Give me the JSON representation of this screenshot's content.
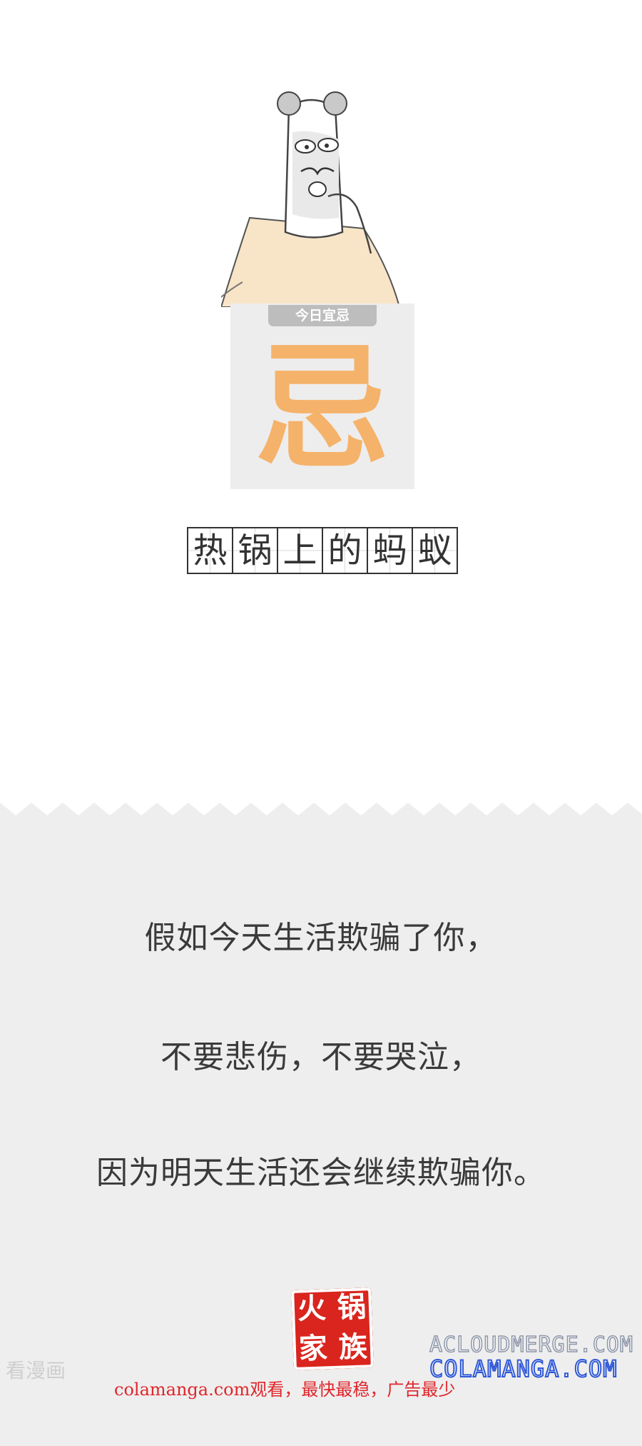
{
  "card": {
    "tag": "今日宜忌",
    "glyph": "忌"
  },
  "title": {
    "characters": [
      "热",
      "锅",
      "上",
      "的",
      "蚂",
      "蚁"
    ]
  },
  "quote": {
    "line1": "假如今天生活欺骗了你，",
    "line2": "不要悲伤，不要哭泣，",
    "line3": "因为明天生活还会继续欺骗你。"
  },
  "seal": {
    "characters": [
      "火",
      "锅",
      "家",
      "族"
    ]
  },
  "footer": {
    "watermark": "看漫画",
    "ad": "colamanga.com观看，最快最稳，广告最少",
    "brand_top": "ACLOUDMERGE.COM",
    "brand_bottom": "COLAMANGA.COM"
  },
  "colors": {
    "accent": "#f5b26a",
    "panel": "#eeeeee",
    "seal": "#d9251d",
    "ad": "#e0252b"
  }
}
